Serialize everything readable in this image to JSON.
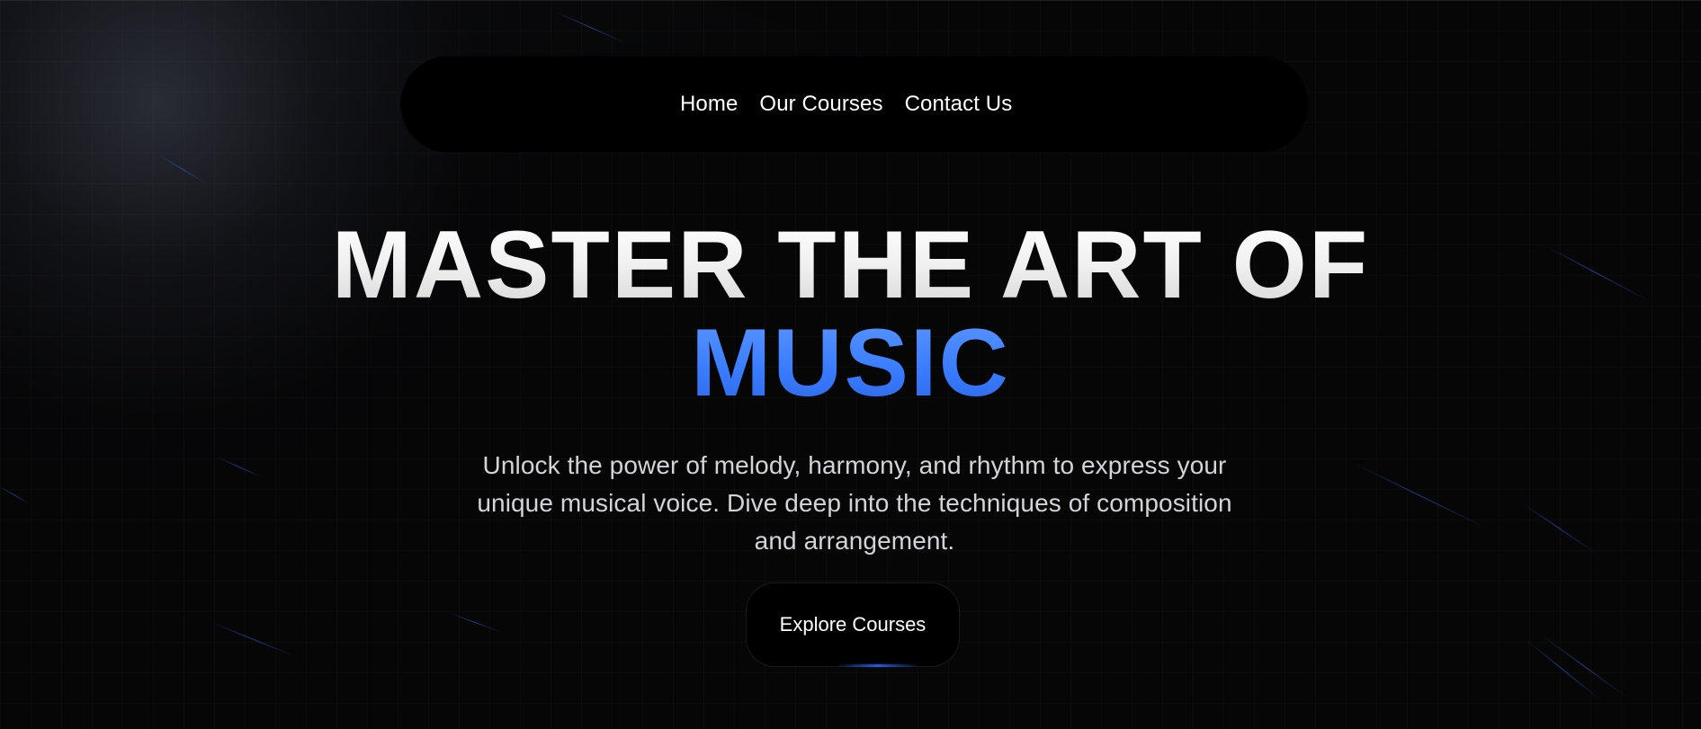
{
  "nav": {
    "items": [
      {
        "label": "Home"
      },
      {
        "label": "Our Courses"
      },
      {
        "label": "Contact Us"
      }
    ]
  },
  "hero": {
    "headline_line_1": "MASTER THE ART OF",
    "headline_line_2": "MUSIC",
    "subtitle": "Unlock the power of melody, harmony, and rhythm to express your unique musical voice. Dive deep into the techniques of composition and arrangement.",
    "cta_label": "Explore Courses"
  },
  "colors": {
    "background": "#060607",
    "nav_background": "#000000",
    "headline_white": "#f5f5f5",
    "accent_blue": "#3b7dff",
    "subtitle_text": "#d4d4d8"
  }
}
